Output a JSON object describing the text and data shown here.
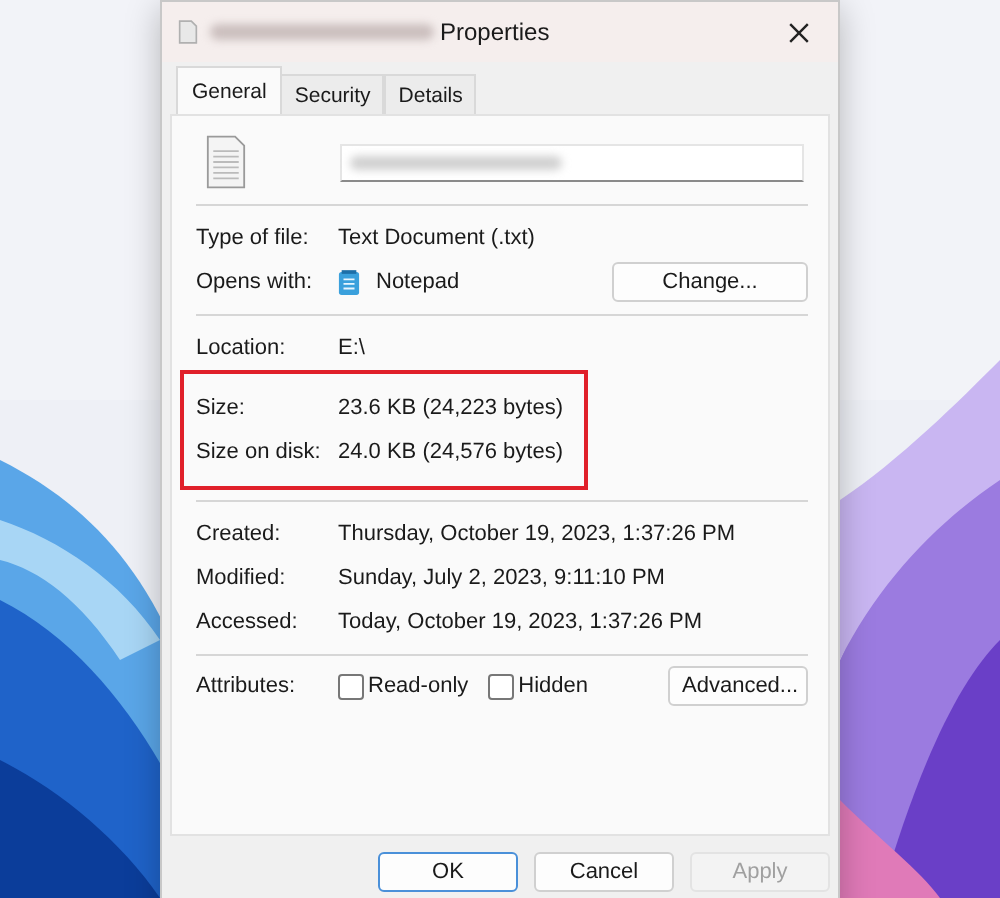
{
  "window": {
    "title": "Properties"
  },
  "tabs": [
    {
      "label": "General",
      "selected": true
    },
    {
      "label": "Security",
      "selected": false
    },
    {
      "label": "Details",
      "selected": false
    }
  ],
  "file_name": {
    "blurred": true
  },
  "sections": [
    {
      "rows": [
        {
          "label": "Type of file:",
          "value": "Text Document (.txt)",
          "highlighted": false
        },
        {
          "label": "Opens with:",
          "value": "Notepad",
          "kind": "app",
          "button": "Change...",
          "highlighted": false
        }
      ]
    },
    {
      "rows": [
        {
          "label": "Location:",
          "value": "E:\\",
          "highlighted": false
        },
        {
          "label": "Size:",
          "value": "23.6 KB (24,223 bytes)",
          "highlighted": true
        },
        {
          "label": "Size on disk:",
          "value": "24.0 KB (24,576 bytes)",
          "highlighted": true
        }
      ]
    },
    {
      "rows": [
        {
          "label": "Created:",
          "value": "Thursday, October 19, 2023, 1:37:26 PM",
          "highlighted": false
        },
        {
          "label": "Modified:",
          "value": "Sunday, July 2, 2023, 9:11:10 PM",
          "highlighted": false
        },
        {
          "label": "Accessed:",
          "value": "Today, October 19, 2023, 1:37:26 PM",
          "highlighted": false
        }
      ]
    }
  ],
  "attributes": {
    "label": "Attributes:",
    "checkboxes": [
      {
        "label": "Read-only",
        "checked": false
      },
      {
        "label": "Hidden",
        "checked": false
      }
    ],
    "button": "Advanced..."
  },
  "buttons": [
    {
      "label": "OK",
      "kind": "default",
      "disabled": false
    },
    {
      "label": "Cancel",
      "kind": "normal",
      "disabled": false
    },
    {
      "label": "Apply",
      "kind": "normal",
      "disabled": true
    }
  ]
}
